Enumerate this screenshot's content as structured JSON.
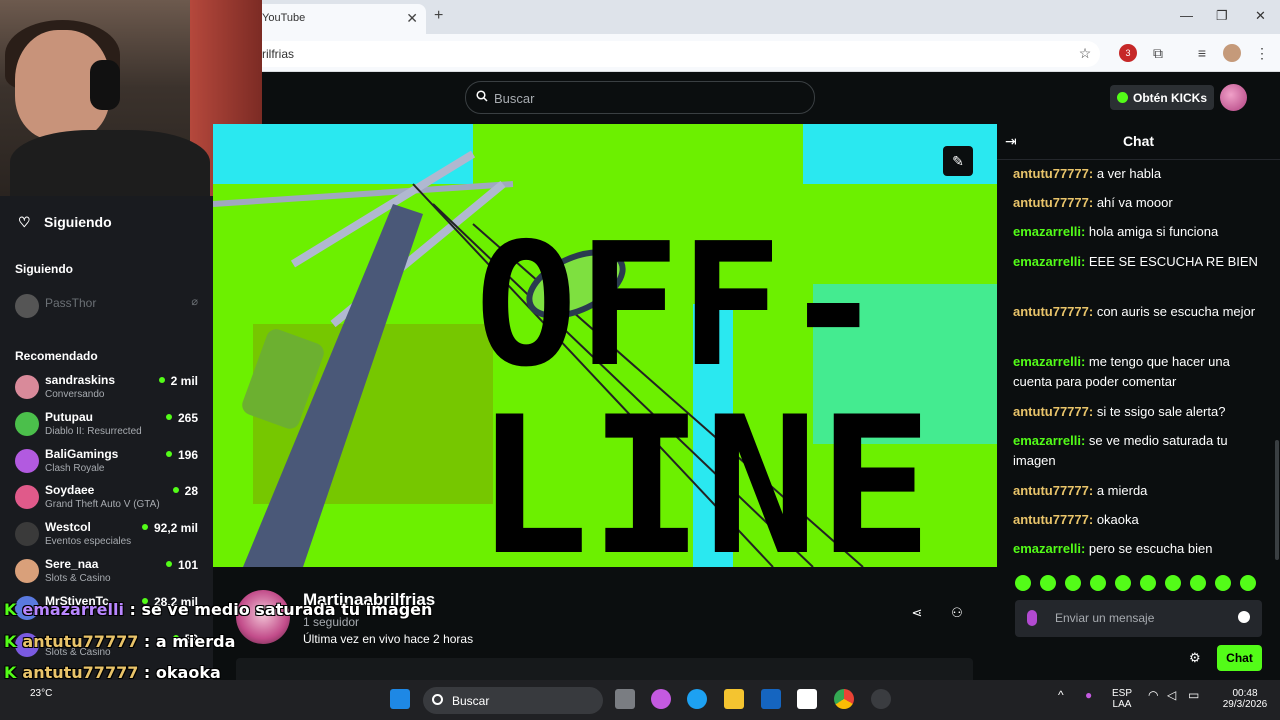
{
  "browser": {
    "tab_title": "YouTube",
    "tab_close": "✕",
    "new_tab": "+",
    "address": "rilfrias",
    "window_controls": [
      "—",
      "❐",
      "✕"
    ],
    "toolbar_badge": "3"
  },
  "kick_header": {
    "search_placeholder": "Buscar",
    "kicks_button": "Obtén KICKs"
  },
  "sidebar": {
    "following_nav": "Siguiendo",
    "following_heading": "Siguiendo",
    "following": [
      {
        "name": "PassThor"
      }
    ],
    "recommended_heading": "Recomendado",
    "recommended": [
      {
        "name": "sandraskins",
        "category": "Conversando",
        "viewers": "2 mil",
        "color": "#d98a9a"
      },
      {
        "name": "Putupau",
        "category": "Diablo II: Resurrected",
        "viewers": "265",
        "color": "#4bbf4b"
      },
      {
        "name": "BaliGamings",
        "category": "Clash Royale",
        "viewers": "196",
        "color": "#b25ae0"
      },
      {
        "name": "Soydaee",
        "category": "Grand Theft Auto V (GTA)",
        "viewers": "28",
        "color": "#e05a8a"
      },
      {
        "name": "Westcol",
        "category": "Eventos especiales",
        "viewers": "92,2 mil",
        "color": "#3a3a3a"
      },
      {
        "name": "Sere_naa",
        "category": "Slots & Casino",
        "viewers": "101",
        "color": "#d9a07a"
      },
      {
        "name": "MrStivenTc",
        "category": "",
        "viewers": "28,2 mil",
        "color": "#5a7ae0"
      },
      {
        "name": "",
        "category": "Slots & Casino",
        "viewers": "59",
        "color": "#7a5ae0"
      }
    ]
  },
  "video": {
    "offline_line1": "OFF-",
    "offline_line2": "LINE"
  },
  "channel": {
    "name": "Martinaabrilfrias",
    "followers": "1 seguidor",
    "last_live": "Última vez en vivo hace 2 horas"
  },
  "chat": {
    "title": "Chat",
    "messages": [
      {
        "user": "antutu77777",
        "text": "a ver habla"
      },
      {
        "user": "antutu77777",
        "text": "ahí va mooor"
      },
      {
        "user": "emazarrelli",
        "text": "hola amiga si funciona"
      },
      {
        "user": "emazarrelli",
        "text": "EEE SE ESCUCHA RE BIEN"
      },
      {
        "user": "antutu77777",
        "text": "con auris se escucha mejor"
      },
      {
        "user": "emazarrelli",
        "text": "me tengo que hacer una cuenta para poder comentar"
      },
      {
        "user": "antutu77777",
        "text": "si te ssigo sale alerta?"
      },
      {
        "user": "emazarrelli",
        "text": "se ve medio saturada tu imagen"
      },
      {
        "user": "antutu77777",
        "text": "a mierda"
      },
      {
        "user": "antutu77777",
        "text": "okaoka"
      },
      {
        "user": "emazarrelli",
        "text": "pero se escucha bien"
      }
    ],
    "input_placeholder": "Enviar un mensaje",
    "send_label": "Chat"
  },
  "overlay_chat": [
    {
      "user": "emazarrelli",
      "text": "se ve medio saturada tu imagen"
    },
    {
      "user": "antutu77777",
      "text": "a mierda"
    },
    {
      "user": "antutu77777",
      "text": "okaoka"
    },
    {
      "user": "emazarrelli",
      "text": "pero se escucha bien"
    }
  ],
  "taskbar": {
    "weather": "23°C",
    "search": "Buscar",
    "lang_top": "ESP",
    "lang_bottom": "LAA",
    "time": "00:48",
    "date": "29/3/2026"
  },
  "colors": {
    "kick_green": "#53fc18",
    "chat_user_a": "#e9c46a",
    "chat_user_e": "#53fc18"
  }
}
